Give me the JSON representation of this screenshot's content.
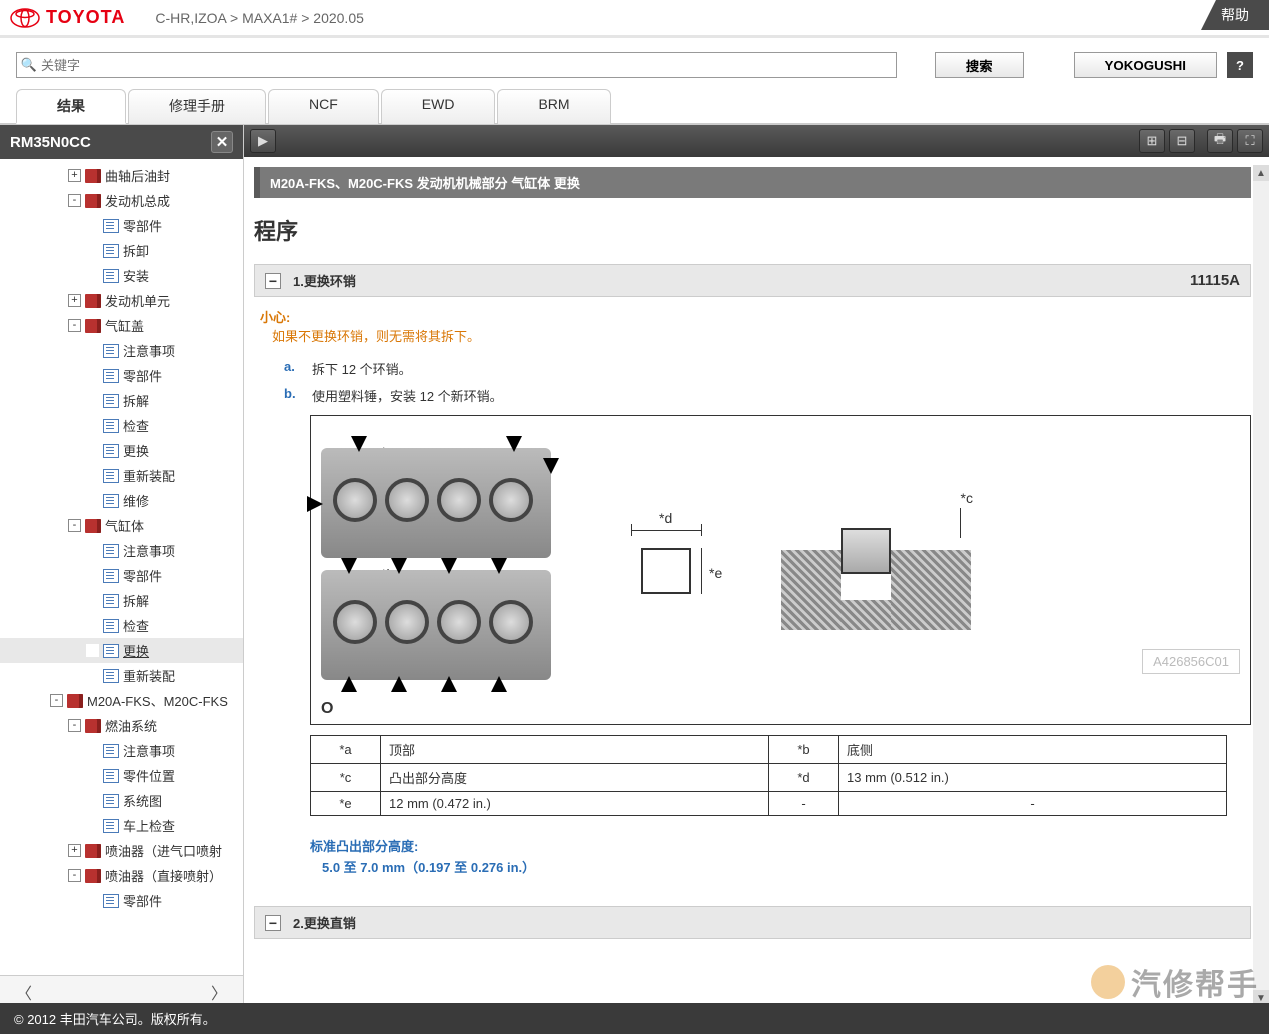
{
  "header": {
    "brand": "TOYOTA",
    "breadcrumb": "C-HR,IZOA > MAXA1# > 2020.05",
    "help": "帮助"
  },
  "search": {
    "placeholder": "关键字",
    "search_btn": "搜索",
    "yokogushi_btn": "YOKOGUSHI",
    "help_q": "?"
  },
  "tabs": [
    "结果",
    "修理手册",
    "NCF",
    "EWD",
    "BRM"
  ],
  "doc_id": "RM35N0CC",
  "tree": [
    {
      "ind": 2,
      "exp": "+",
      "icon": "book",
      "label": "曲轴后油封"
    },
    {
      "ind": 2,
      "exp": "-",
      "icon": "book",
      "label": "发动机总成"
    },
    {
      "ind": 3,
      "exp": "",
      "icon": "doc",
      "label": "零部件"
    },
    {
      "ind": 3,
      "exp": "",
      "icon": "doc",
      "label": "拆卸"
    },
    {
      "ind": 3,
      "exp": "",
      "icon": "doc",
      "label": "安装"
    },
    {
      "ind": 2,
      "exp": "+",
      "icon": "book",
      "label": "发动机单元"
    },
    {
      "ind": 2,
      "exp": "-",
      "icon": "book",
      "label": "气缸盖"
    },
    {
      "ind": 3,
      "exp": "",
      "icon": "doc",
      "label": "注意事项"
    },
    {
      "ind": 3,
      "exp": "",
      "icon": "doc",
      "label": "零部件"
    },
    {
      "ind": 3,
      "exp": "",
      "icon": "doc",
      "label": "拆解"
    },
    {
      "ind": 3,
      "exp": "",
      "icon": "doc",
      "label": "检查"
    },
    {
      "ind": 3,
      "exp": "",
      "icon": "doc",
      "label": "更换"
    },
    {
      "ind": 3,
      "exp": "",
      "icon": "doc",
      "label": "重新装配"
    },
    {
      "ind": 3,
      "exp": "",
      "icon": "doc",
      "label": "维修"
    },
    {
      "ind": 2,
      "exp": "-",
      "icon": "book",
      "label": "气缸体"
    },
    {
      "ind": 3,
      "exp": "",
      "icon": "doc",
      "label": "注意事项"
    },
    {
      "ind": 3,
      "exp": "",
      "icon": "doc",
      "label": "零部件"
    },
    {
      "ind": 3,
      "exp": "",
      "icon": "doc",
      "label": "拆解"
    },
    {
      "ind": 3,
      "exp": "",
      "icon": "doc",
      "label": "检查"
    },
    {
      "ind": 3,
      "exp": "",
      "icon": "doc",
      "label": "更换",
      "sel": true
    },
    {
      "ind": 3,
      "exp": "",
      "icon": "doc",
      "label": "重新装配"
    },
    {
      "ind": 1,
      "exp": "-",
      "icon": "book",
      "label": "M20A-FKS、M20C-FKS"
    },
    {
      "ind": 2,
      "exp": "-",
      "icon": "book",
      "label": "燃油系统"
    },
    {
      "ind": 3,
      "exp": "",
      "icon": "doc",
      "label": "注意事项"
    },
    {
      "ind": 3,
      "exp": "",
      "icon": "doc",
      "label": "零件位置"
    },
    {
      "ind": 3,
      "exp": "",
      "icon": "doc",
      "label": "系统图"
    },
    {
      "ind": 3,
      "exp": "",
      "icon": "doc",
      "label": "车上检查"
    },
    {
      "ind": 2,
      "exp": "+",
      "icon": "book",
      "label": "喷油器（进气口喷射"
    },
    {
      "ind": 2,
      "exp": "-",
      "icon": "book",
      "label": "喷油器（直接喷射）"
    },
    {
      "ind": 3,
      "exp": "",
      "icon": "doc",
      "label": "零部件"
    }
  ],
  "content": {
    "title_bar": "M20A-FKS、M20C-FKS 发动机机械部分  气缸体  更换",
    "h_procedure": "程序",
    "step1": {
      "num": "1.更换环销",
      "code": "11115A"
    },
    "hint_label": "小心:",
    "hint_text": "如果不更换环销，则无需将其拆下。",
    "sub_a": {
      "letter": "a.",
      "text": "拆下 12 个环销。"
    },
    "sub_b": {
      "letter": "b.",
      "text": "使用塑料锤，安装 12 个新环销。"
    },
    "fig": {
      "la": "*a",
      "lb": "*b",
      "lc": "*c",
      "ld": "*d",
      "le": "*e",
      "img_code": "A426856C01",
      "o": "O"
    },
    "table": {
      "r1": {
        "k1": "*a",
        "v1": "顶部",
        "k2": "*b",
        "v2": "底侧"
      },
      "r2": {
        "k1": "*c",
        "v1": "凸出部分高度",
        "k2": "*d",
        "v2": "13 mm (0.512 in.)"
      },
      "r3": {
        "k1": "*e",
        "v1": "12 mm (0.472 in.)",
        "k2": "-",
        "v2": "-"
      }
    },
    "std_label": "标准凸出部分高度:",
    "std_val": "5.0 至 7.0 mm（0.197 至 0.276 in.）",
    "step2": {
      "num": "2.更换直销"
    }
  },
  "footer": "© 2012 丰田汽车公司。版权所有。",
  "watermark": "汽修帮手"
}
